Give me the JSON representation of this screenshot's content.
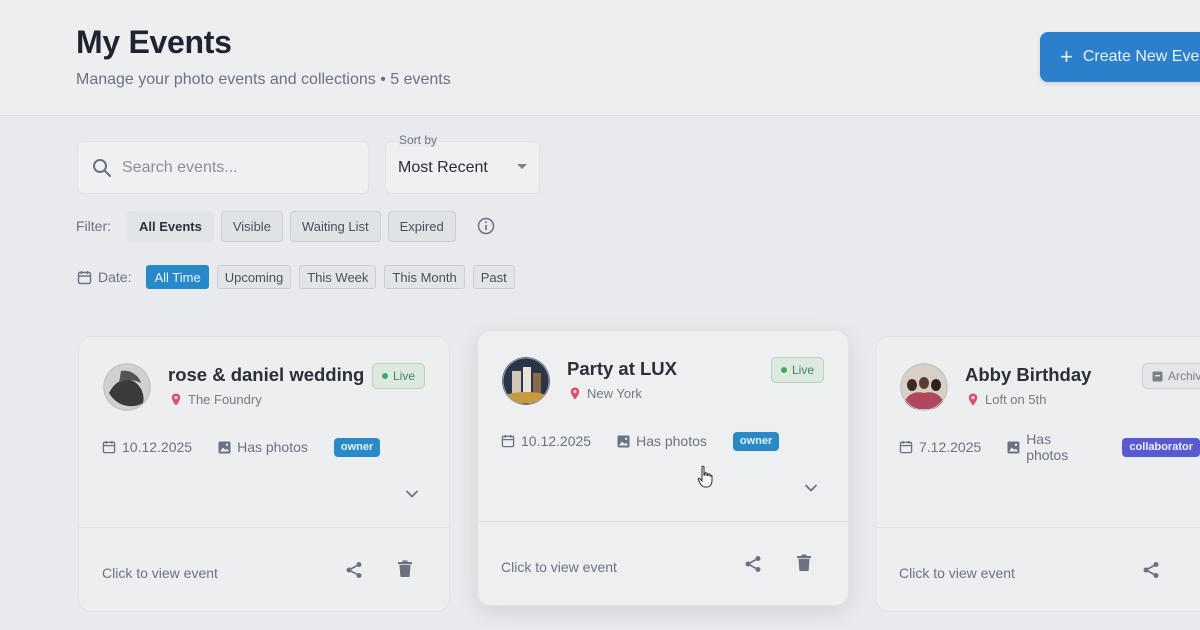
{
  "header": {
    "title": "My Events",
    "subtitle": "Manage your photo events and collections • 5 events",
    "create_button": "Create New Event"
  },
  "search": {
    "placeholder": "Search events..."
  },
  "sort": {
    "label": "Sort by",
    "value": "Most Recent"
  },
  "filter": {
    "label": "Filter:",
    "chips": [
      "All Events",
      "Visible",
      "Waiting List",
      "Expired"
    ],
    "active": "All Events"
  },
  "date_filter": {
    "label": "Date:",
    "chips": [
      "All Time",
      "Upcoming",
      "This Week",
      "This Month",
      "Past"
    ],
    "active": "All Time"
  },
  "events": [
    {
      "title": "rose & daniel wedding",
      "location": "The Foundry",
      "status": "Live",
      "date": "10.12.2025",
      "photos": "Has photos",
      "role": "owner",
      "footer": "Click to view event"
    },
    {
      "title": "Party at LUX",
      "location": "New York",
      "status": "Live",
      "date": "10.12.2025",
      "photos": "Has photos",
      "role": "owner",
      "footer": "Click to view event"
    },
    {
      "title": "Abby Birthday",
      "location": "Loft on 5th",
      "status": "Archived",
      "date": "7.12.2025",
      "photos": "Has photos",
      "role": "collaborator",
      "footer": "Click to view event"
    }
  ],
  "colors": {
    "accent": "#2b7fcb",
    "live": "#3d8a55",
    "owner": "#2a8ac7",
    "collaborator": "#5959d0"
  }
}
